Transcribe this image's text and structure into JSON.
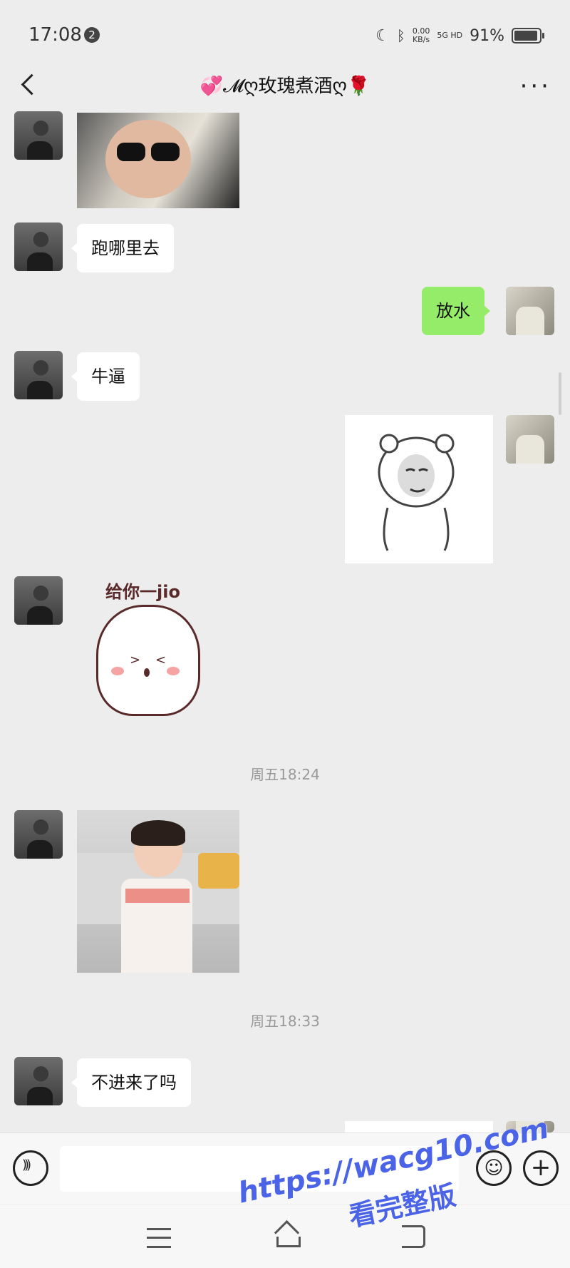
{
  "status_bar": {
    "time": "17:08",
    "notification_badge": "2",
    "net_speed_value": "0.00",
    "net_speed_unit": "KB/s",
    "signal_label": "5G HD",
    "battery_percent": "91%"
  },
  "header": {
    "title": "💞𝓜ღ玫瑰煮酒ღ🌹"
  },
  "messages": [
    {
      "side": "in",
      "type": "image",
      "content": "photo"
    },
    {
      "side": "in",
      "type": "text",
      "text": "跑哪里去"
    },
    {
      "side": "out",
      "type": "text",
      "text": "放水"
    },
    {
      "side": "in",
      "type": "text",
      "text": "牛逼"
    },
    {
      "side": "out",
      "type": "sticker",
      "content": "meme face"
    },
    {
      "side": "in",
      "type": "sticker",
      "text": "给你一jio"
    },
    {
      "side": "in",
      "type": "image",
      "content": "photo"
    },
    {
      "side": "in",
      "type": "text",
      "text": "不进来了吗"
    }
  ],
  "timestamps": [
    "周五18:24",
    "周五18:33"
  ],
  "input_bar": {
    "emoji_glyph": "☺",
    "plus_glyph": "+"
  },
  "watermark": {
    "url": "https://wacg10.com",
    "caption": "看完整版"
  },
  "colors": {
    "background": "#ededed",
    "outgoing_bubble": "#95ec69",
    "incoming_bubble": "#ffffff",
    "watermark": "#4b63e6"
  }
}
